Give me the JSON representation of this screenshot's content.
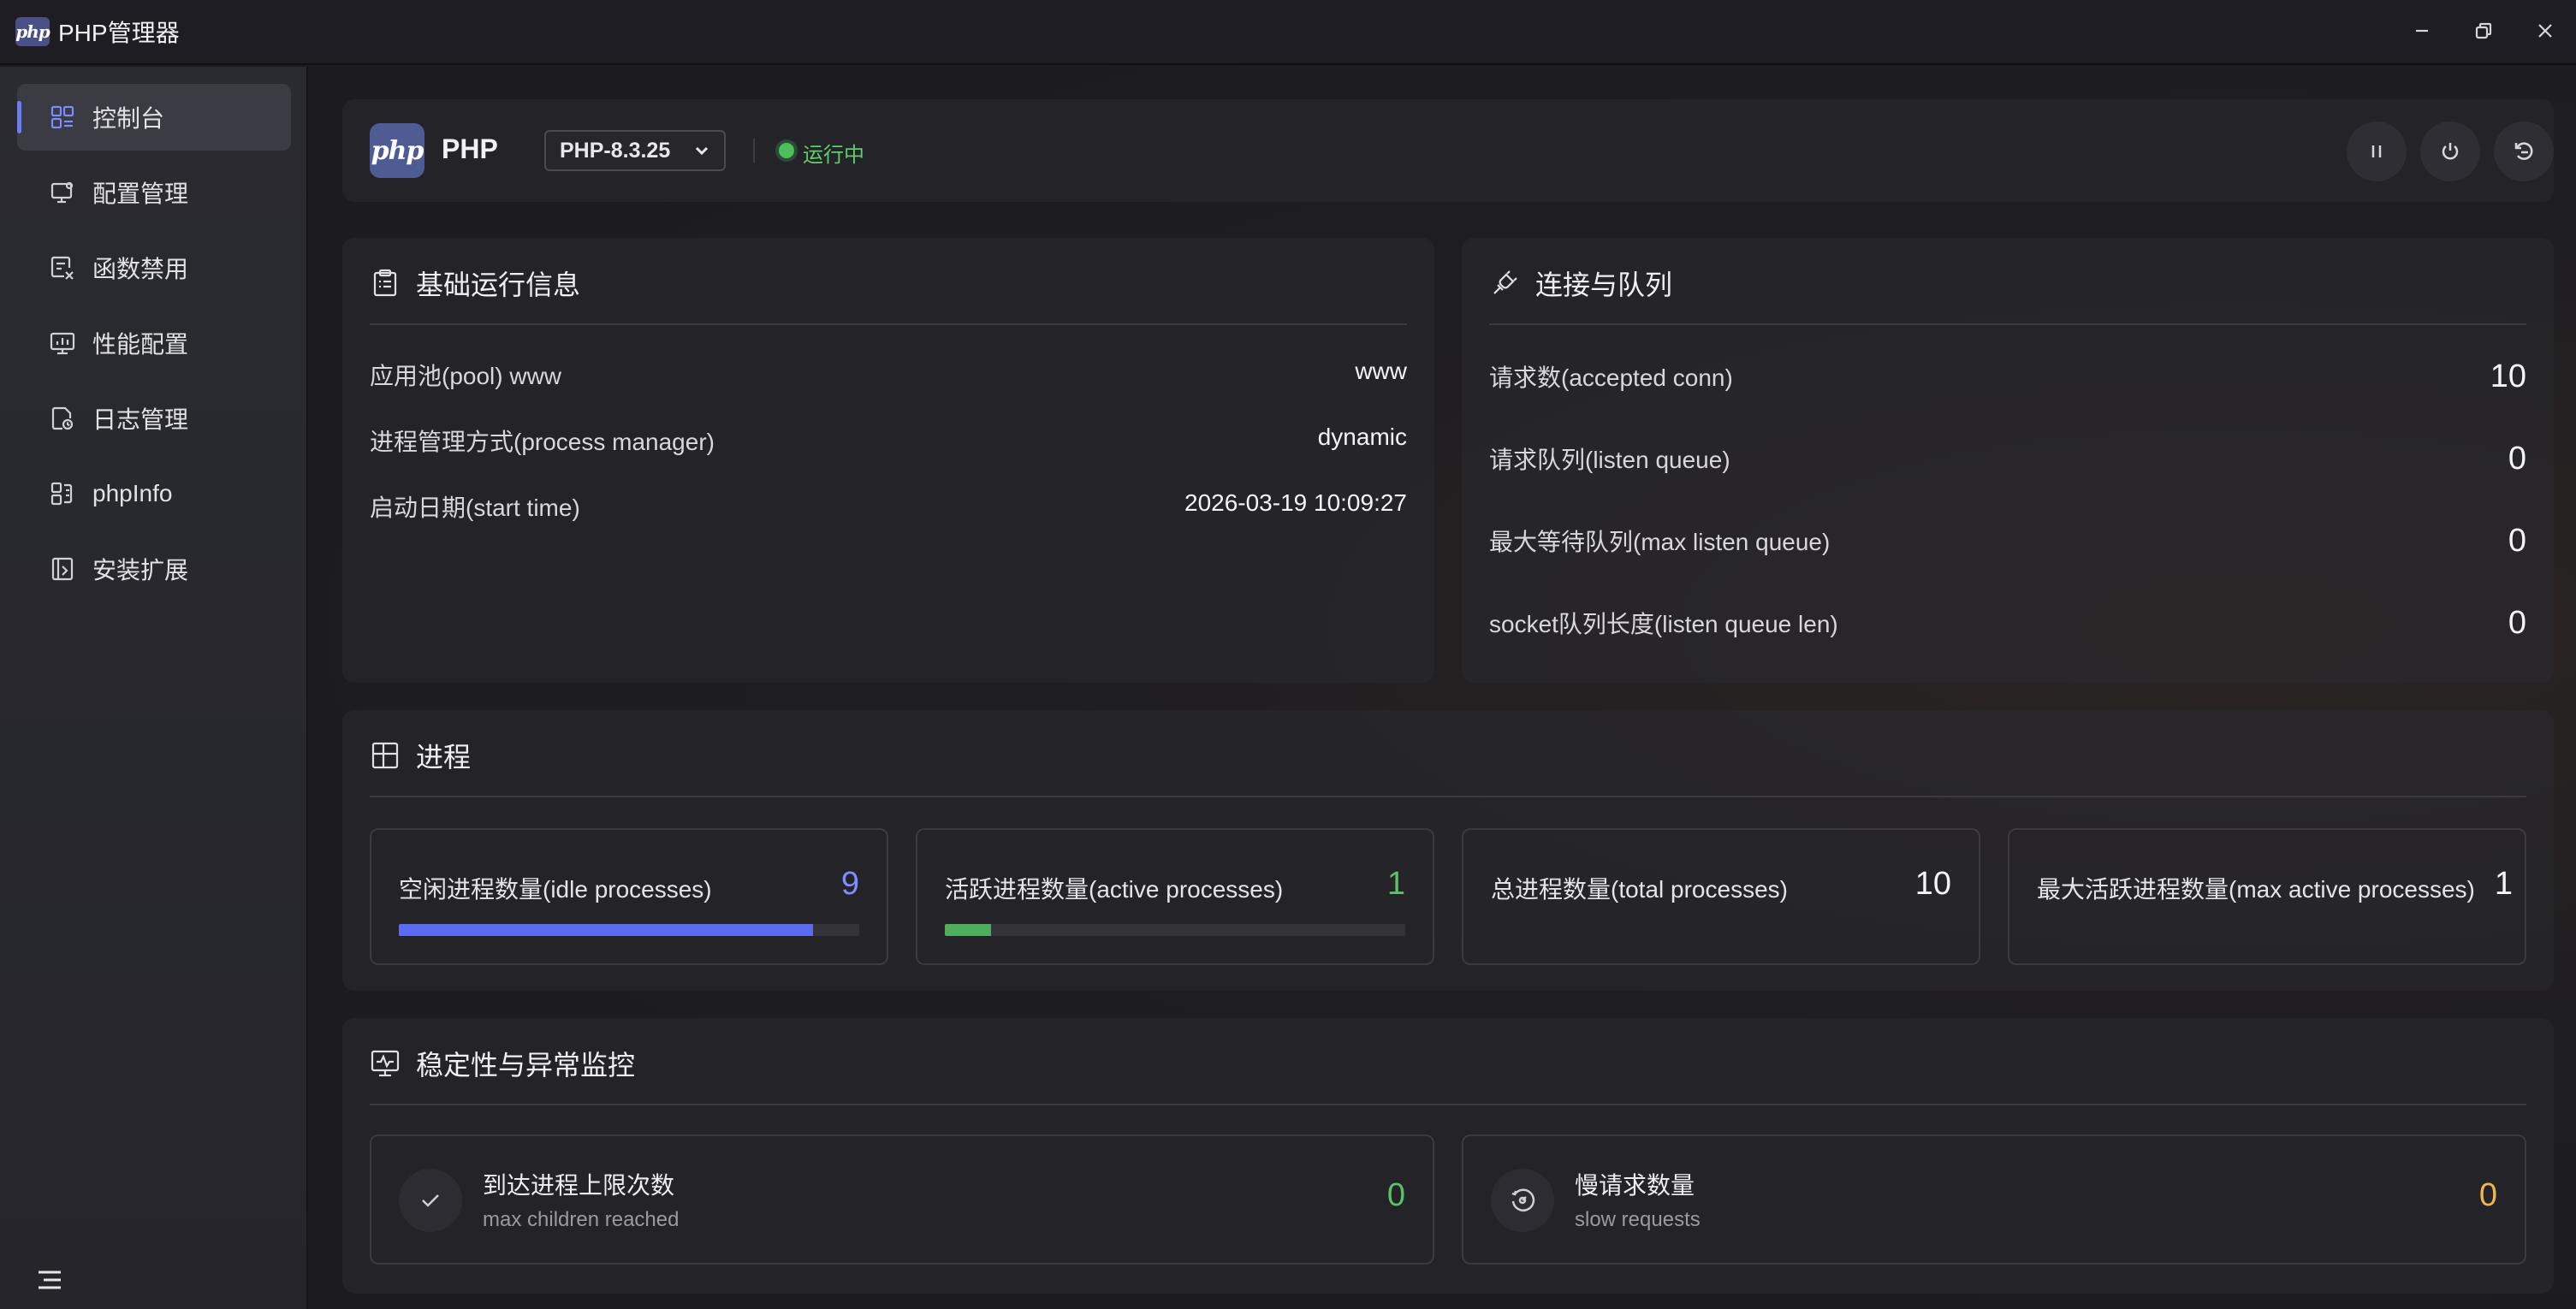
{
  "app": {
    "title": "PHP管理器",
    "logo_text": "php"
  },
  "sidebar": {
    "items": [
      {
        "label": "控制台",
        "icon": "dashboard-icon",
        "active": true
      },
      {
        "label": "配置管理",
        "icon": "config-icon"
      },
      {
        "label": "函数禁用",
        "icon": "function-disable-icon"
      },
      {
        "label": "性能配置",
        "icon": "performance-icon"
      },
      {
        "label": "日志管理",
        "icon": "log-icon"
      },
      {
        "label": "phpInfo",
        "icon": "phpinfo-icon"
      },
      {
        "label": "安装扩展",
        "icon": "extension-icon"
      }
    ],
    "collapse_icon": "menu-collapse-icon"
  },
  "header": {
    "logo_text": "php",
    "name": "PHP",
    "version": "PHP-8.3.25",
    "status": "运行中",
    "status_color": "#5ccf6a",
    "actions": [
      "pause-icon",
      "power-icon",
      "restart-icon"
    ]
  },
  "basic_info": {
    "title": "基础运行信息",
    "rows": [
      {
        "label": "应用池(pool) www",
        "value": "www"
      },
      {
        "label": "进程管理方式(process manager)",
        "value": "dynamic"
      },
      {
        "label": "启动日期(start time)",
        "value": "2026-03-19 10:09:27"
      }
    ]
  },
  "connections": {
    "title": "连接与队列",
    "rows": [
      {
        "label": "请求数(accepted conn)",
        "value": "10"
      },
      {
        "label": "请求队列(listen queue)",
        "value": "0"
      },
      {
        "label": "最大等待队列(max listen queue)",
        "value": "0"
      },
      {
        "label": "socket队列长度(listen queue len)",
        "value": "0"
      }
    ]
  },
  "processes": {
    "title": "进程",
    "stats": [
      {
        "label": "空闲进程数量(idle processes)",
        "value": "9",
        "color": "#7f8cff",
        "progress": 0.9,
        "bar_color": "#5b6cf0"
      },
      {
        "label": "活跃进程数量(active processes)",
        "value": "1",
        "color": "#5cc06a",
        "progress": 0.1,
        "bar_color": "#4fae5e"
      },
      {
        "label": "总进程数量(total processes)",
        "value": "10",
        "color": "#f4f4f6"
      },
      {
        "label": "最大活跃进程数量(max active processes)",
        "value": "1",
        "color": "#f4f4f6"
      }
    ]
  },
  "stability": {
    "title": "稳定性与异常监控",
    "items": [
      {
        "title": "到达进程上限次数",
        "subtitle": "max children reached",
        "value": "0",
        "color": "#5cc06a",
        "icon": "check-icon"
      },
      {
        "title": "慢请求数量",
        "subtitle": "slow requests",
        "value": "0",
        "color": "#f0b64a",
        "icon": "slow-clock-icon"
      }
    ]
  }
}
